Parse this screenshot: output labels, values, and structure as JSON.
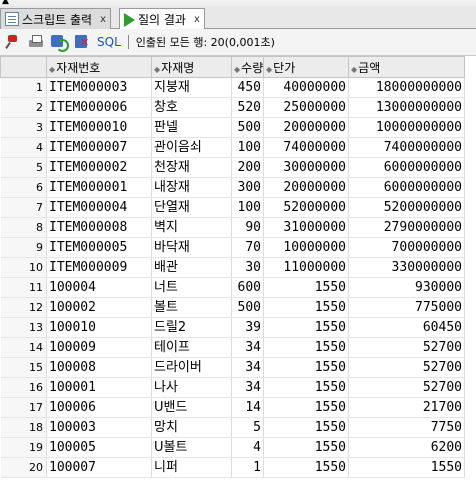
{
  "tabs": [
    {
      "label": "스크립트 출력",
      "close": "x"
    },
    {
      "label": "질의 결과",
      "close": "x"
    }
  ],
  "toolbar": {
    "sql_label": "SQL",
    "status_text": "인출된 모든 행: 20(0,001초)"
  },
  "columns": [
    "",
    "자재번호",
    "자재명",
    "수량",
    "단가",
    "금액"
  ],
  "rows": [
    {
      "rn": "1",
      "code": "ITEM000003",
      "name": "지붕재",
      "qty": "450",
      "price": "40000000",
      "amount": "18000000000"
    },
    {
      "rn": "2",
      "code": "ITEM000006",
      "name": "창호",
      "qty": "520",
      "price": "25000000",
      "amount": "13000000000"
    },
    {
      "rn": "3",
      "code": "ITEM000010",
      "name": "판넬",
      "qty": "500",
      "price": "20000000",
      "amount": "10000000000"
    },
    {
      "rn": "4",
      "code": "ITEM000007",
      "name": "관이음쇠",
      "qty": "100",
      "price": "74000000",
      "amount": "7400000000"
    },
    {
      "rn": "5",
      "code": "ITEM000002",
      "name": "천장재",
      "qty": "200",
      "price": "30000000",
      "amount": "6000000000"
    },
    {
      "rn": "6",
      "code": "ITEM000001",
      "name": "내장재",
      "qty": "300",
      "price": "20000000",
      "amount": "6000000000"
    },
    {
      "rn": "7",
      "code": "ITEM000004",
      "name": "단열재",
      "qty": "100",
      "price": "52000000",
      "amount": "5200000000"
    },
    {
      "rn": "8",
      "code": "ITEM000008",
      "name": "벽지",
      "qty": "90",
      "price": "31000000",
      "amount": "2790000000"
    },
    {
      "rn": "9",
      "code": "ITEM000005",
      "name": "바닥재",
      "qty": "70",
      "price": "10000000",
      "amount": "700000000"
    },
    {
      "rn": "10",
      "code": "ITEM000009",
      "name": "배관",
      "qty": "30",
      "price": "11000000",
      "amount": "330000000"
    },
    {
      "rn": "11",
      "code": "100004",
      "name": "너트",
      "qty": "600",
      "price": "1550",
      "amount": "930000"
    },
    {
      "rn": "12",
      "code": "100002",
      "name": "볼트",
      "qty": "500",
      "price": "1550",
      "amount": "775000"
    },
    {
      "rn": "13",
      "code": "100010",
      "name": "드릴2",
      "qty": "39",
      "price": "1550",
      "amount": "60450"
    },
    {
      "rn": "14",
      "code": "100009",
      "name": "테이프",
      "qty": "34",
      "price": "1550",
      "amount": "52700"
    },
    {
      "rn": "15",
      "code": "100008",
      "name": "드라이버",
      "qty": "34",
      "price": "1550",
      "amount": "52700"
    },
    {
      "rn": "16",
      "code": "100001",
      "name": "나사",
      "qty": "34",
      "price": "1550",
      "amount": "52700"
    },
    {
      "rn": "17",
      "code": "100006",
      "name": "U밴드",
      "qty": "14",
      "price": "1550",
      "amount": "21700"
    },
    {
      "rn": "18",
      "code": "100003",
      "name": "망치",
      "qty": "5",
      "price": "1550",
      "amount": "7750"
    },
    {
      "rn": "19",
      "code": "100005",
      "name": "U볼트",
      "qty": "4",
      "price": "1550",
      "amount": "6200"
    },
    {
      "rn": "20",
      "code": "100007",
      "name": "니퍼",
      "qty": "1",
      "price": "1550",
      "amount": "1550"
    }
  ]
}
